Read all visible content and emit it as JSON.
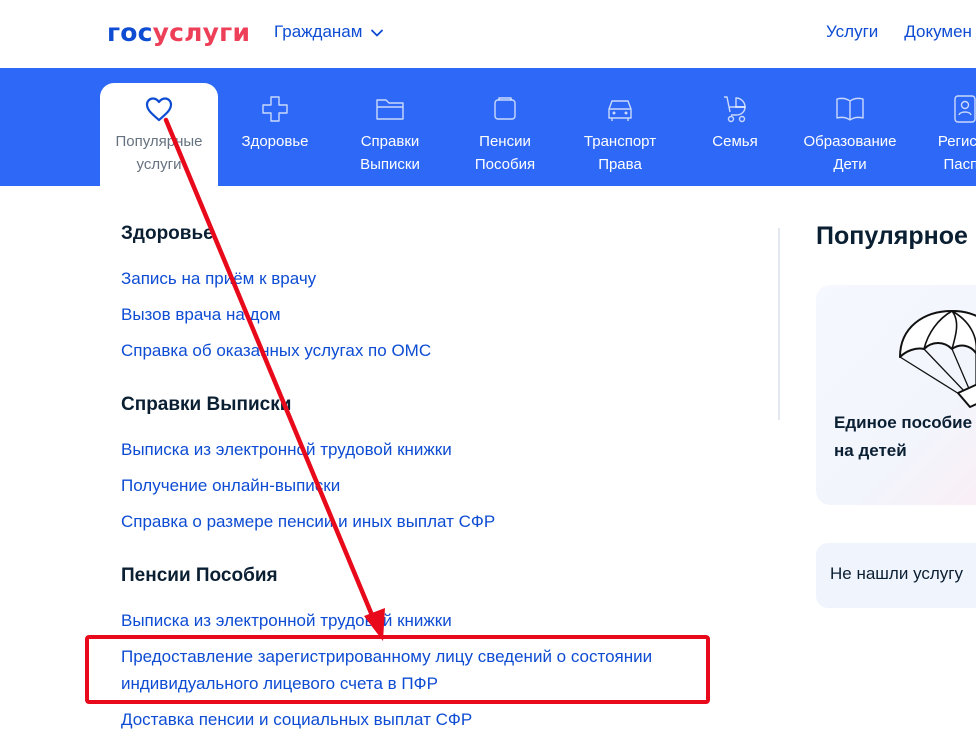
{
  "header": {
    "logo_part1": "гос",
    "logo_part2": "услуги",
    "audience": "Гражданам",
    "nav": [
      "Услуги",
      "Докумен"
    ]
  },
  "categories": [
    {
      "label_line1": "Популярные",
      "label_line2": "услуги",
      "icon": "heart-icon",
      "active": true
    },
    {
      "label_line1": "Здоровье",
      "label_line2": "",
      "icon": "medical-cross-icon",
      "active": false
    },
    {
      "label_line1": "Справки",
      "label_line2": "Выписки",
      "icon": "folder-icon",
      "active": false
    },
    {
      "label_line1": "Пенсии",
      "label_line2": "Пособия",
      "icon": "wallet-icon",
      "active": false
    },
    {
      "label_line1": "Транспорт",
      "label_line2": "Права",
      "icon": "car-icon",
      "active": false
    },
    {
      "label_line1": "Семья",
      "label_line2": "",
      "icon": "stroller-icon",
      "active": false
    },
    {
      "label_line1": "Образование",
      "label_line2": "Дети",
      "icon": "book-icon",
      "active": false
    },
    {
      "label_line1": "Регистр",
      "label_line2": "Паспо",
      "icon": "id-card-icon",
      "active": false
    }
  ],
  "sections": [
    {
      "title": "Здоровье",
      "links": [
        "Запись на приём к врачу",
        "Вызов врача на дом",
        "Справка об оказанных услугах по ОМС"
      ]
    },
    {
      "title": "Справки Выписки",
      "links": [
        "Выписка из электронной трудовой книжки",
        "Получение онлайн-выписки",
        "Справка о размере пенсии и иных выплат СФР"
      ]
    },
    {
      "title": "Пенсии Пособия",
      "links": [
        "Выписка из электронной трудовой книжки",
        "Предоставление зарегистрированному лицу сведений о состоянии",
        "индивидуального лицевого счета в ПФР",
        "Доставка пенсии и социальных выплат СФР"
      ]
    }
  ],
  "right": {
    "popular_title": "Популярное",
    "card_title_line1": "Единое пособие",
    "card_title_line2": "на детей",
    "not_found": "Не нашли услугу"
  },
  "colors": {
    "brand_blue": "#0d4cd3",
    "brand_red": "#ee3f58",
    "bar_blue": "#2e68f6",
    "annotation_red": "#e8091b"
  }
}
